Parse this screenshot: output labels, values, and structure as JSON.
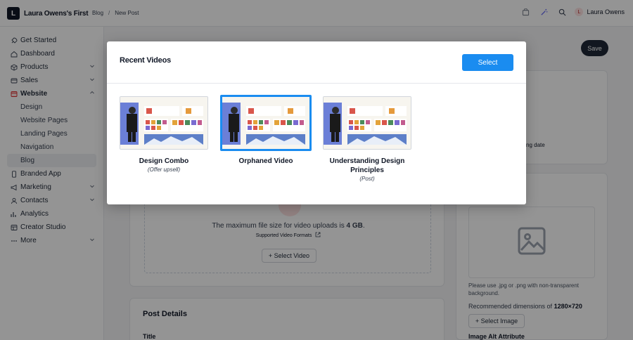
{
  "app": {
    "brand_name": "Laura Owens's First",
    "brand_initial": "L"
  },
  "breadcrumb": [
    "Blog",
    "New Post"
  ],
  "user": {
    "name": "Laura Owens",
    "initial": "L"
  },
  "sidebar": {
    "items": [
      {
        "label": "Get Started",
        "icon": "rocket-icon"
      },
      {
        "label": "Dashboard",
        "icon": "dashboard-icon"
      },
      {
        "label": "Products",
        "icon": "box-icon",
        "chevron": "down"
      },
      {
        "label": "Sales",
        "icon": "sales-icon",
        "chevron": "down"
      },
      {
        "label": "Website",
        "icon": "website-icon",
        "chevron": "up"
      },
      {
        "label": "Branded App",
        "icon": "phone-icon"
      },
      {
        "label": "Marketing",
        "icon": "megaphone-icon",
        "chevron": "down"
      },
      {
        "label": "Contacts",
        "icon": "contacts-icon",
        "chevron": "down"
      },
      {
        "label": "Analytics",
        "icon": "analytics-icon"
      },
      {
        "label": "Creator Studio",
        "icon": "studio-icon"
      },
      {
        "label": "More",
        "icon": "more-icon",
        "chevron": "down"
      }
    ],
    "website_sub": [
      "Design",
      "Website Pages",
      "Landing Pages",
      "Navigation",
      "Blog"
    ],
    "selected_sub": "Blog"
  },
  "page": {
    "save_label": "Save",
    "publish_date_label": "ishing date",
    "upload_text_prefix": "The maximum file size for video uploads is ",
    "upload_size": "4 GB",
    "supported_formats": "Supported Video Formats",
    "select_video": "+ Select Video",
    "image_note": "Please use .jpg or .png with non-transparent background.",
    "recommended_label": "Recommended dimensions of ",
    "recommended_value": "1280×720",
    "select_image": "+ Select Image",
    "image_alt_label": "Image Alt Attribute",
    "post_details": "Post Details",
    "title_label": "Title"
  },
  "modal": {
    "title": "Recent Videos",
    "select_label": "Select",
    "videos": [
      {
        "title": "Design Combo",
        "subtitle": "(Offer upsell)",
        "selected": false
      },
      {
        "title": "Orphaned Video",
        "subtitle": "",
        "selected": true
      },
      {
        "title": "Understanding Design Principles",
        "subtitle": "(Post)",
        "selected": false
      }
    ]
  },
  "colors": {
    "accent": "#1a8cf0",
    "save_button": "#1f2937",
    "overlay": "rgba(0,0,0,0.42)"
  }
}
